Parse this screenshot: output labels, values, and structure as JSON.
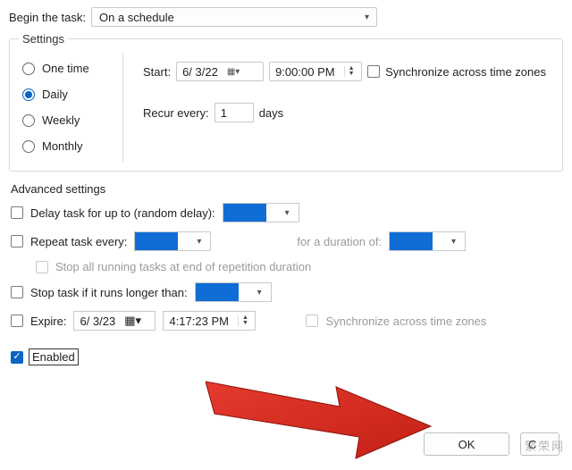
{
  "begin": {
    "label": "Begin the task:",
    "value": "On a schedule"
  },
  "settings": {
    "legend": "Settings",
    "radios": {
      "one_time": "One time",
      "daily": "Daily",
      "weekly": "Weekly",
      "monthly": "Monthly",
      "selected": "daily"
    },
    "start_label": "Start:",
    "start_date": "6/ 3/22",
    "start_time": "9:00:00 PM",
    "sync_label": "Synchronize across time zones",
    "recur_label": "Recur every:",
    "recur_value": "1",
    "recur_unit": "days"
  },
  "advanced": {
    "title": "Advanced settings",
    "delay_label": "Delay task for up to (random delay):",
    "repeat_label": "Repeat task every:",
    "for_duration_label": "for a duration of:",
    "stop_repeat_label": "Stop all running tasks at end of repetition duration",
    "stop_longer_label": "Stop task if it runs longer than:",
    "expire_label": "Expire:",
    "expire_date": "6/ 3/23",
    "expire_time": "4:17:23 PM",
    "sync_label": "Synchronize across time zones",
    "enabled_label": "Enabled"
  },
  "buttons": {
    "ok": "OK",
    "cancel_frag": "C"
  },
  "watermark": {
    "w1": "",
    "w2": "繁荣网"
  }
}
